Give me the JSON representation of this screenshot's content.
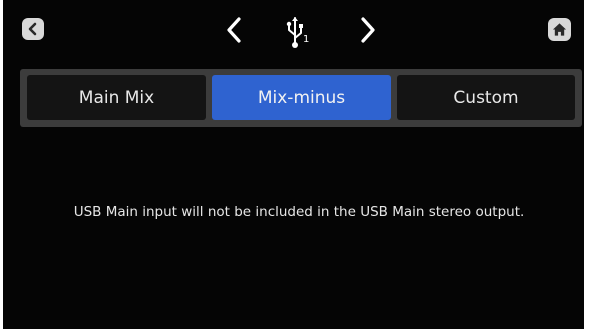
{
  "header": {
    "back_icon": "chevron-left-icon",
    "prev_icon": "chevron-left-icon",
    "next_icon": "chevron-right-icon",
    "usb_icon": "usb-icon",
    "usb_index": "1",
    "home_icon": "home-icon"
  },
  "tabs": [
    {
      "label": "Main Mix",
      "selected": false
    },
    {
      "label": "Mix-minus",
      "selected": true
    },
    {
      "label": "Custom",
      "selected": false
    }
  ],
  "message": "USB Main input will not be included in the USB Main stereo output.",
  "colors": {
    "background": "#050505",
    "tab_selected": "#2f63d0",
    "tab_unselected": "#141414",
    "tabbar_frame": "#3c3c3c",
    "button_bg": "#d9d9d9"
  }
}
